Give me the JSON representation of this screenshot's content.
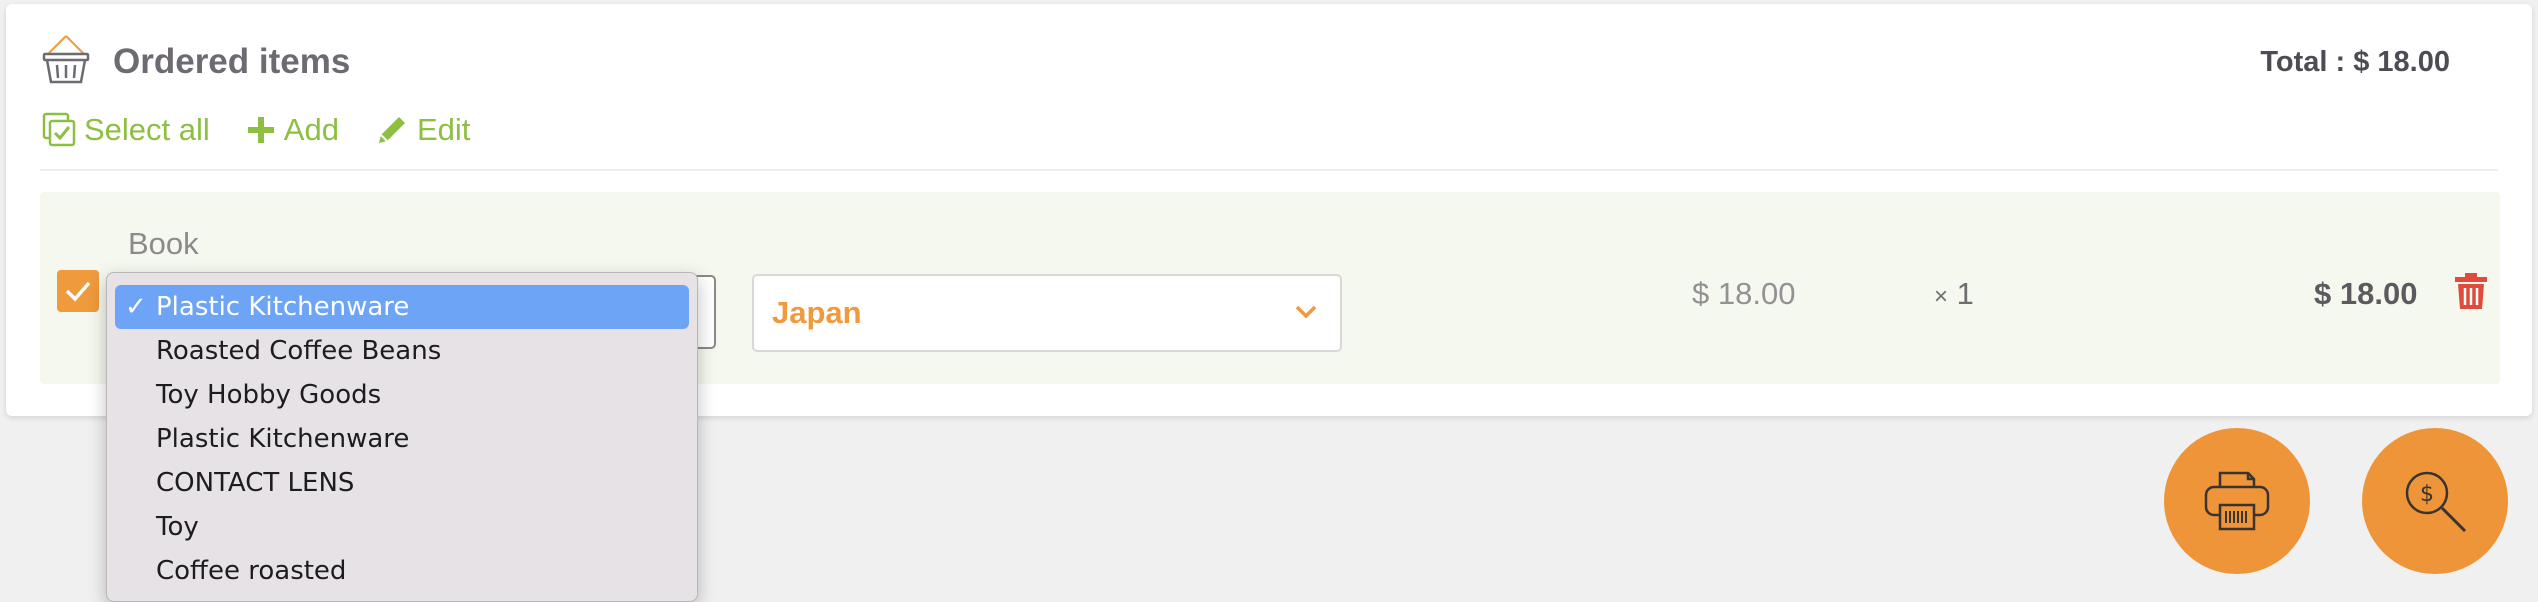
{
  "header": {
    "title": "Ordered items",
    "total": "Total : $ 18.00"
  },
  "toolbar": {
    "select_all": "Select all",
    "add": "Add",
    "edit": "Edit"
  },
  "item": {
    "name": "Book",
    "country": "Japan",
    "unit_price": "$ 18.00",
    "qty_symbol": "×",
    "qty": "1",
    "line_total": "$ 18.00"
  },
  "dropdown": {
    "selected_tick": "✓",
    "options": [
      "Plastic Kitchenware",
      "Roasted Coffee Beans",
      "Toy Hobby Goods",
      "Plastic Kitchenware",
      "CONTACT LENS",
      "Toy",
      "Coffee roasted"
    ]
  },
  "colors": {
    "accent_green": "#8dbf42",
    "accent_orange": "#ef9a3d",
    "delete_red": "#e14b3b",
    "selection_blue": "#6ea4f6"
  },
  "icons": {
    "header": "basket-icon",
    "select_all": "checkbox-check-icon",
    "add": "plus-icon",
    "edit": "pencil-icon",
    "delete": "trash-icon",
    "fab_print": "printer-icon",
    "fab_search": "dollar-search-icon"
  }
}
